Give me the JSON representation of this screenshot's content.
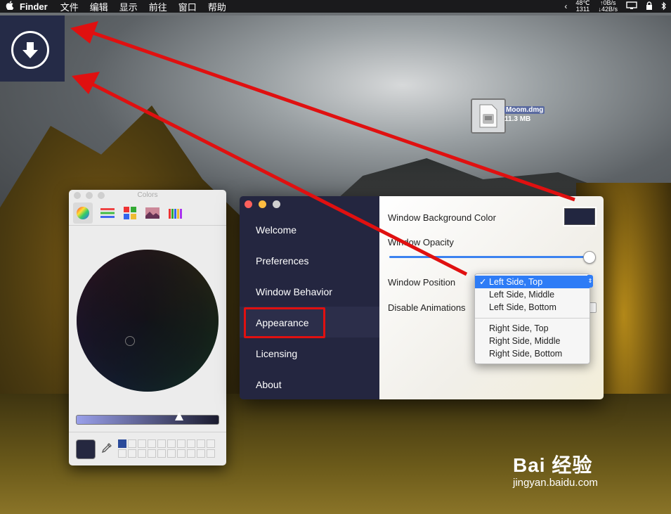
{
  "menubar": {
    "app_name": "Finder",
    "items": [
      "文件",
      "编辑",
      "显示",
      "前往",
      "窗口",
      "帮助"
    ],
    "status": {
      "temp": "48℃",
      "rpm": "1311",
      "up": "↑0B/s",
      "down": "↓42B/s"
    }
  },
  "desktop_file": {
    "name": "Moom.dmg",
    "size": "11.3 MB"
  },
  "colors_panel": {
    "title": "Colors",
    "selected_color": "#252840"
  },
  "prefs": {
    "nav": [
      "Welcome",
      "Preferences",
      "Window Behavior",
      "Appearance",
      "Licensing",
      "About"
    ],
    "selected_nav": "Appearance",
    "labels": {
      "bg_color": "Window Background Color",
      "opacity": "Window Opacity",
      "position": "Window Position",
      "animations": "Disable Animations"
    },
    "bg_color_value": "#222640",
    "opacity_value": 1.0,
    "position_options": [
      "Left Side, Top",
      "Left Side, Middle",
      "Left Side, Bottom",
      "Right Side, Top",
      "Right Side, Middle",
      "Right Side, Bottom"
    ],
    "position_selected": "Left Side, Top",
    "check_mark": "✓"
  },
  "watermark": {
    "brand": "Bai 经验",
    "url": "jingyan.baidu.com"
  },
  "colors": {
    "accent": "#2e7cf6",
    "annotation": "#e01010",
    "sidebar": "#242640"
  }
}
